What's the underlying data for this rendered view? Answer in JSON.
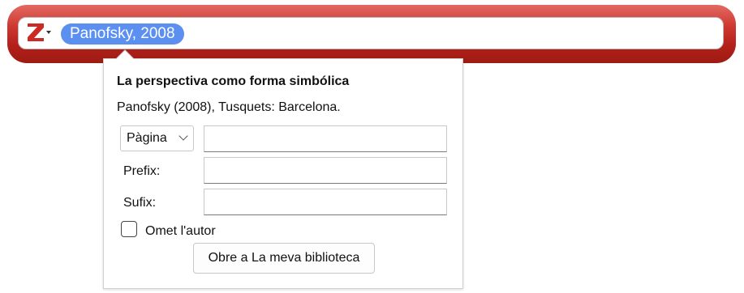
{
  "toolbar": {
    "brand_color": "#cf3b33",
    "logo_icon": "zotero-z-icon",
    "citation_pill": "Panofsky, 2008"
  },
  "popup": {
    "item_title": "La perspectiva como forma simbólica",
    "item_citation": "Panofsky (2008), Tusquets: Barcelona.",
    "locator_select": "Pàgina",
    "locator_value": "",
    "prefix_label": "Prefix:",
    "prefix_value": "",
    "suffix_label": "Sufix:",
    "suffix_value": "",
    "omit_author_label": "Omet l'autor",
    "omit_author_checked": false,
    "open_library_button": "Obre a La meva biblioteca"
  }
}
